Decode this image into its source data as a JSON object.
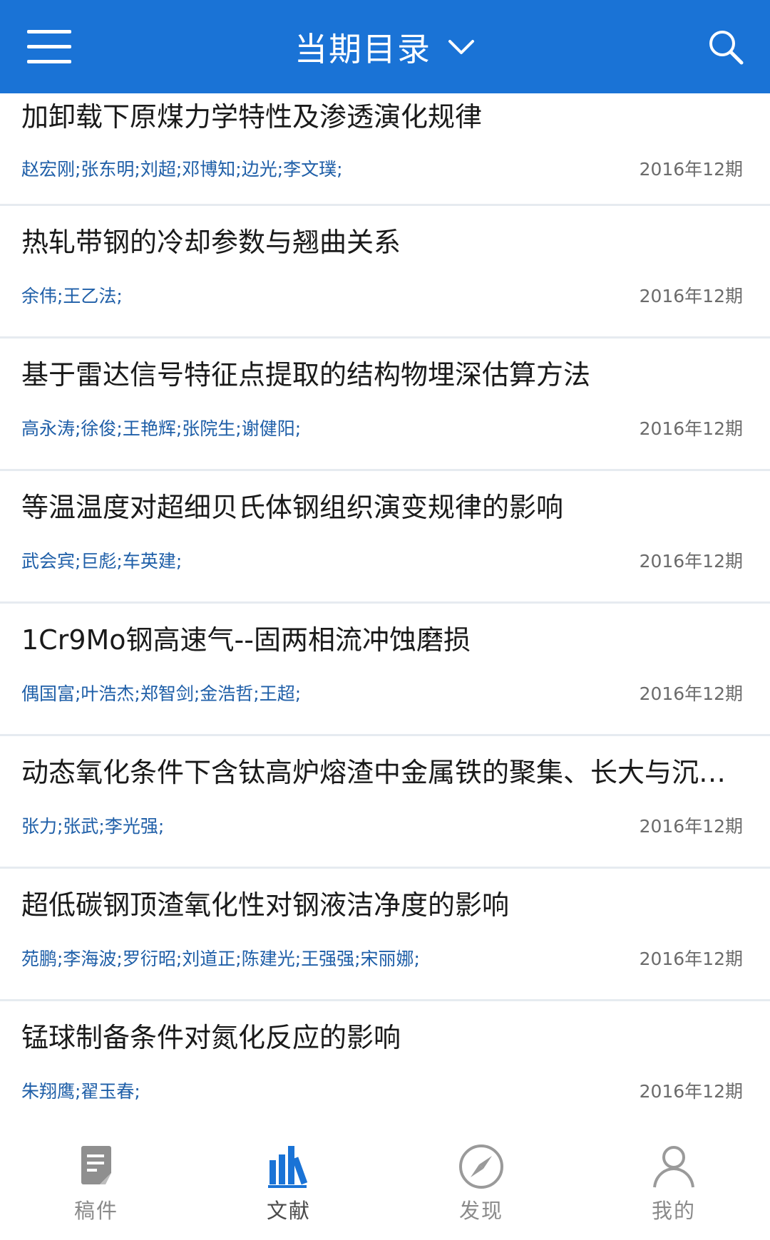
{
  "header": {
    "title": "当期目录"
  },
  "articles": [
    {
      "title": "加卸载下原煤力学特性及渗透演化规律",
      "authors": "赵宏刚;张东明;刘超;邓博知;边光;李文璞;",
      "issue": "2016年12期"
    },
    {
      "title": "热轧带钢的冷却参数与翘曲关系",
      "authors": "余伟;王乙法;",
      "issue": "2016年12期"
    },
    {
      "title": "基于雷达信号特征点提取的结构物埋深估算方法",
      "authors": "高永涛;徐俊;王艳辉;张院生;谢健阳;",
      "issue": "2016年12期"
    },
    {
      "title": "等温温度对超细贝氏体钢组织演变规律的影响",
      "authors": "武会宾;巨彪;车英建;",
      "issue": "2016年12期"
    },
    {
      "title": "1Cr9Mo钢高速气--固两相流冲蚀磨损",
      "authors": "偶国富;叶浩杰;郑智剑;金浩哲;王超;",
      "issue": "2016年12期"
    },
    {
      "title": "动态氧化条件下含钛高炉熔渣中金属铁的聚集、长大与沉…",
      "authors": "张力;张武;李光强;",
      "issue": "2016年12期"
    },
    {
      "title": "超低碳钢顶渣氧化性对钢液洁净度的影响",
      "authors": "苑鹏;李海波;罗衍昭;刘道正;陈建光;王强强;宋丽娜;",
      "issue": "2016年12期"
    },
    {
      "title": "锰球制备条件对氮化反应的影响",
      "authors": "朱翔鹰;翟玉春;",
      "issue": "2016年12期"
    }
  ],
  "bottom_nav": {
    "items": [
      {
        "label": "稿件",
        "icon": "manuscript-icon"
      },
      {
        "label": "文献",
        "icon": "library-icon"
      },
      {
        "label": "发现",
        "icon": "compass-icon"
      },
      {
        "label": "我的",
        "icon": "user-icon"
      }
    ],
    "active_index": 1
  },
  "colors": {
    "header_bg": "#1a73d6",
    "author_text": "#1f5fa8",
    "active_nav_icon": "#1a73d6",
    "inactive_nav_icon": "#9a9a9a"
  }
}
